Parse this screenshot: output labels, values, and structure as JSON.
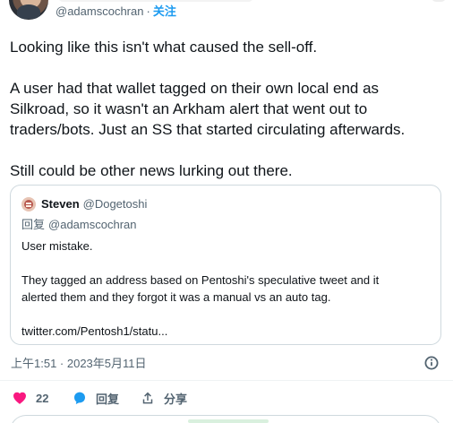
{
  "header": {
    "handle": "@adamscochran",
    "separator": "·",
    "follow_label": "关注"
  },
  "tweet": {
    "paragraphs": [
      "Looking like this isn't what caused the sell-off.",
      "A user had that wallet tagged on their own local end as",
      "Silkroad, so it wasn't an Arkham alert that went out to",
      "traders/bots. Just an SS that started circulating afterwards.",
      "Still could be other news lurking out there."
    ]
  },
  "quote": {
    "author_name": "Steven",
    "author_handle": "@Dogetoshi",
    "reply_prefix": "回复",
    "reply_handle": "@adamscochran",
    "text_lines": [
      "User mistake.",
      "They tagged an address based on Pentoshi's speculative tweet and it",
      "alerted them and they forgot it was a manual vs an auto tag.",
      "twitter.com/Pentosh1/statu..."
    ]
  },
  "meta": {
    "timestamp": "上午1:51 · 2023年5月11日"
  },
  "actions": {
    "like_count": "22",
    "reply_label": "回复",
    "share_label": "分享"
  },
  "icons": {
    "info": "info-icon",
    "heart": "heart-icon",
    "reply": "speech-bubble-icon",
    "share": "upload-arrow-icon",
    "follow_color": "#1d9bf0",
    "heart_color": "#f91880",
    "reply_color": "#1d9bf0"
  }
}
